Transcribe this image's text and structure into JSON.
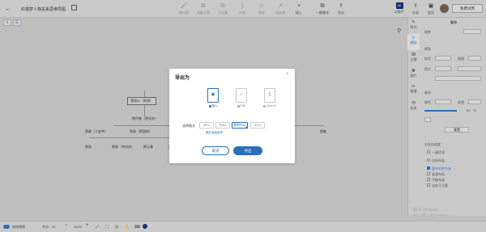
{
  "header": {
    "doc_title": "红楼梦人物关系思维导图",
    "tools": [
      {
        "icon": "format-painter-icon",
        "glyph": "🖌",
        "label": "格式刷"
      },
      {
        "icon": "sibling-topic-icon",
        "glyph": "⊞",
        "label": "同级主题"
      },
      {
        "icon": "sub-topic-icon",
        "glyph": "⊟",
        "label": "子主题"
      },
      {
        "icon": "summary-icon",
        "glyph": "}",
        "label": "外框"
      },
      {
        "icon": "callout-icon",
        "glyph": "◇",
        "label": "概要"
      },
      {
        "icon": "relation-icon",
        "glyph": "↗",
        "label": "关联线"
      },
      {
        "icon": "insert-icon",
        "glyph": "+",
        "label": "插入"
      },
      {
        "icon": "layout-icon",
        "glyph": "⧉",
        "label": "一键美化"
      },
      {
        "icon": "export-icon",
        "glyph": "⇪",
        "label": "导出"
      }
    ],
    "right_tools": [
      {
        "icon": "ai-icon",
        "glyph": "AI",
        "label": "AI助手"
      },
      {
        "icon": "share-icon",
        "glyph": "⇧",
        "label": "分享"
      },
      {
        "icon": "upgrade-icon",
        "glyph": "▣",
        "label": "会员"
      },
      {
        "icon": "download-icon",
        "glyph": "⬇",
        "label": "下载"
      }
    ],
    "vip_label": "免费试用"
  },
  "canvas": {
    "root": "荣国公（贾源）",
    "level1": [
      {
        "label": "贾代善（贾母夫）"
      }
    ],
    "level2": [
      {
        "label": "贾赦（大老爷）"
      },
      {
        "label": "贾政（荣国府）"
      },
      {
        "label": "贾敏"
      }
    ],
    "level3": [
      {
        "label": "贾琏"
      },
      {
        "label": "贾珠（李纨夫）"
      },
      {
        "label": "贾元春"
      },
      {
        "label": "贾宝玉"
      },
      {
        "label": "贾探春"
      },
      {
        "label": "贾环"
      }
    ]
  },
  "right_panel": {
    "tabs": [
      {
        "icon": "style-icon",
        "glyph": "✎",
        "label": "样式"
      },
      {
        "icon": "icon-icon",
        "glyph": "☺",
        "label": "图标"
      },
      {
        "icon": "structure-icon",
        "glyph": "⊞",
        "label": "主题"
      },
      {
        "icon": "image-icon",
        "glyph": "❀",
        "label": "图片"
      },
      {
        "icon": "link-icon",
        "glyph": "∞",
        "label": "链接"
      },
      {
        "icon": "history-icon",
        "glyph": "⟲",
        "label": "历史"
      }
    ],
    "section_structure": "结构",
    "section_canvas": "画布",
    "section_line": "线条",
    "section_sheet": "画布",
    "section_branch": "分支自由度",
    "section_reset": "全局",
    "reset_label": "重置",
    "lbl_line_style": "样式",
    "lbl_line_width": "粗细",
    "lbl_arrow": "箭头",
    "lbl_sheet_color": "颜色",
    "lbl_sheet_texture": "纹理",
    "lbl_percent": "60",
    "lbl_unit": "%",
    "lbl_options": [
      "一键优化",
      "自由布局",
      "居中对齐分支",
      "紧凑布局",
      "平衡布局",
      "自由子主题"
    ]
  },
  "modal": {
    "title": "导出为",
    "options": [
      {
        "label": "图片",
        "glyph": "▣"
      },
      {
        "label": "PDF",
        "glyph": "≡"
      },
      {
        "label": "Json/小",
        "glyph": "{}"
      }
    ],
    "format_label": "选择格式",
    "formats": [
      "JPG",
      "PNG",
      "透明PNG",
      "SVG"
    ],
    "hint": "图片高级选项",
    "cancel_label": "取消",
    "export_label": "导出"
  },
  "bottom": {
    "status": "结构透视",
    "count_label": "节点：",
    "count_value": "22",
    "zoom": "100%"
  },
  "watermark": {
    "title": "激活 Windows",
    "subtitle": "转到\"设置\"以激活 Windows。"
  }
}
